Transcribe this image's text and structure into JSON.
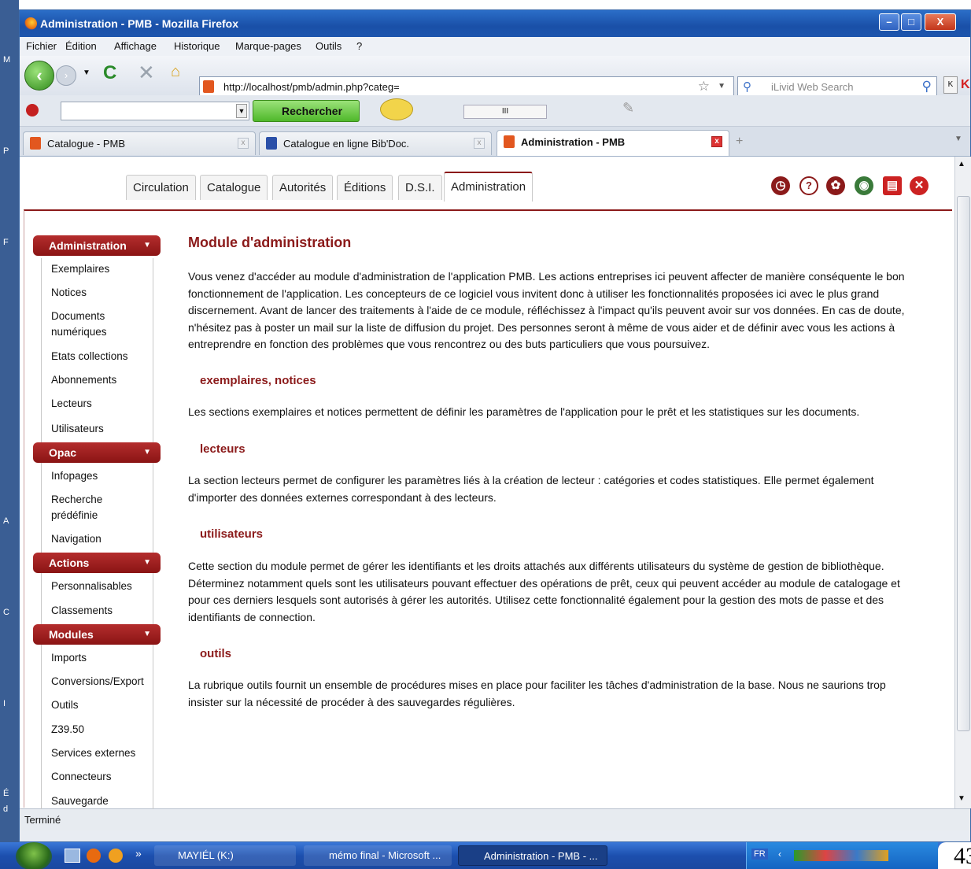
{
  "window": {
    "title": "Administration - PMB - Mozilla Firefox"
  },
  "menubar": [
    "Fichier",
    "Édition",
    "Affichage",
    "Historique",
    "Marque-pages",
    "Outils",
    "?"
  ],
  "address": {
    "url": "http://localhost/pmb/admin.php?categ=",
    "search_placeholder": "iLivid Web Search"
  },
  "toolbar": {
    "rechercher": "Rechercher",
    "scroll_mark": "III"
  },
  "browser_tabs": [
    {
      "label": "Catalogue - PMB"
    },
    {
      "label": "Catalogue en ligne Bib'Doc."
    },
    {
      "label": "Administration - PMB"
    }
  ],
  "page_tabs": [
    "Circulation",
    "Catalogue",
    "Autorités",
    "Éditions",
    "D.S.I.",
    "Administration"
  ],
  "sidebar": {
    "sections": [
      {
        "title": "Administration",
        "items": [
          "Exemplaires",
          "Notices",
          "Documents numériques",
          "Etats collections",
          "Abonnements",
          "Lecteurs",
          "Utilisateurs"
        ]
      },
      {
        "title": "Opac",
        "items": [
          "Infopages",
          "Recherche prédéfinie",
          "Navigation"
        ]
      },
      {
        "title": "Actions",
        "items": [
          "Personnalisables",
          "Classements"
        ]
      },
      {
        "title": "Modules",
        "items": [
          "Imports",
          "Conversions/Export",
          "Outils",
          "Z39.50",
          "Services externes",
          "Connecteurs",
          "Sauvegarde"
        ]
      }
    ]
  },
  "main": {
    "title": "Module d'administration",
    "intro": "Vous venez d'accéder au module d'administration de l'application PMB. Les actions entreprises ici peuvent affecter de manière conséquente le bon fonctionnement de l'application. Les concepteurs de ce logiciel vous invitent donc à utiliser les fonctionnalités proposées ici avec le plus grand discernement. Avant de lancer des traitements à l'aide de ce module, réfléchissez à l'impact qu'ils peuvent avoir sur vos données. En cas de doute, n'hésitez pas à poster un mail sur la liste de diffusion du projet. Des personnes seront à même de vous aider et de définir avec vous les actions à entreprendre en fonction des problèmes que vous rencontrez ou des buts particuliers que vous poursuivez.",
    "sections": [
      {
        "heading": "exemplaires, notices",
        "text": "Les sections exemplaires et notices permettent de définir les paramètres de l'application pour le prêt et les statistiques sur les documents."
      },
      {
        "heading": "lecteurs",
        "text": "La section lecteurs permet de configurer les paramètres liés à la création de lecteur : catégories et codes statistiques. Elle permet également d'importer des données externes correspondant à des lecteurs."
      },
      {
        "heading": "utilisateurs",
        "text": "Cette section du module permet de gérer les identifiants et les droits attachés aux différents utilisateurs du système de gestion de bibliothèque. Déterminez notamment quels sont les utilisateurs pouvant effectuer des opérations de prêt, ceux qui peuvent accéder au module de catalogage et pour ces derniers lesquels sont autorisés à gérer les autorités. Utilisez cette fonctionnalité également pour la gestion des mots de passe et des identifiants de connection."
      },
      {
        "heading": "outils",
        "text": "La rubrique outils fournit un ensemble de procédures mises en place pour faciliter les tâches d'administration de la base. Nous ne saurions trop insister sur la nécessité de procéder à des sauvegardes régulières."
      }
    ]
  },
  "status": "Terminé",
  "taskbar": {
    "items": [
      "MAYIÉL (K:)",
      "mémo final - Microsoft ...",
      "Administration - PMB - ..."
    ],
    "lang": "FR",
    "page_number": "43"
  },
  "desktop_letters": [
    "M",
    "P",
    "F",
    "A",
    "C",
    "I",
    "É",
    "d"
  ]
}
